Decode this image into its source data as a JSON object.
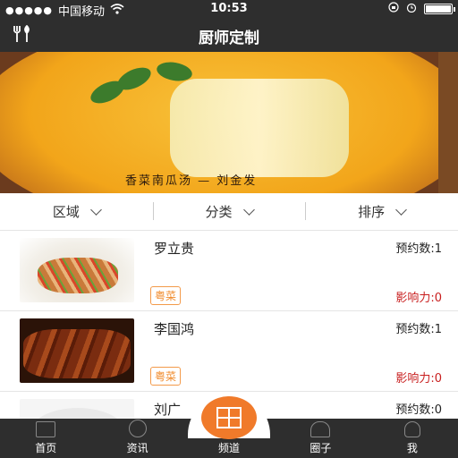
{
  "status_bar": {
    "signal": "●●●●●",
    "carrier": "中国移动",
    "time": "10:53"
  },
  "nav": {
    "title": "厨师定制",
    "left_icon": "cutlery-icon"
  },
  "banner": {
    "caption": "香菜南瓜汤 — 刘金发"
  },
  "filters": [
    {
      "label": "区域"
    },
    {
      "label": "分类"
    },
    {
      "label": "排序"
    }
  ],
  "chefs": [
    {
      "name": "罗立贵",
      "cuisine": "粤菜",
      "bookings": "预约数:1",
      "influence": "影响力:0"
    },
    {
      "name": "李国鸿",
      "cuisine": "粤菜",
      "bookings": "预约数:1",
      "influence": "影响力:0"
    },
    {
      "name": "刘广",
      "cuisine": "",
      "bookings": "预约数:0",
      "influence": ""
    }
  ],
  "tabs": [
    {
      "label": "首页",
      "icon": "home-icon"
    },
    {
      "label": "资讯",
      "icon": "news-icon"
    },
    {
      "label": "频道",
      "icon": "channel-grid-icon"
    },
    {
      "label": "圈子",
      "icon": "circle-heart-icon"
    },
    {
      "label": "我",
      "icon": "profile-icon"
    }
  ],
  "colors": {
    "bar_bg": "#2e2e2e",
    "accent": "#f07a2a",
    "influence": "#c81e1e",
    "tag": "#f08a2a"
  }
}
